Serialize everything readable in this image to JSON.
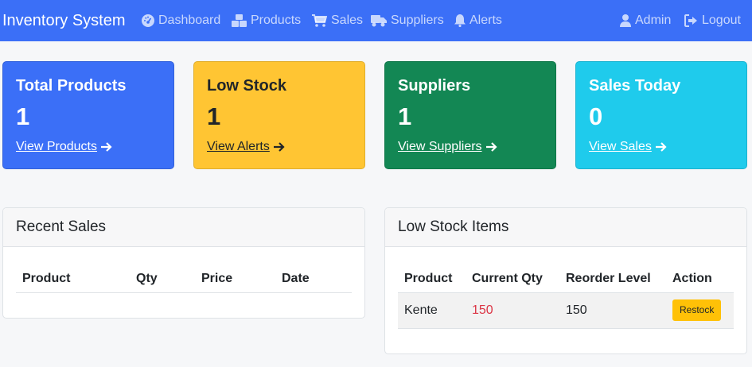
{
  "navbar": {
    "brand": "Inventory System",
    "links": [
      "Dashboard",
      "Products",
      "Sales",
      "Suppliers",
      "Alerts"
    ],
    "admin_label": "Admin",
    "logout_label": "Logout",
    "background": "#3b6ff7"
  },
  "cards": [
    {
      "title": "Total Products",
      "value": "1",
      "link": "View Products",
      "color": "#3b6ff7"
    },
    {
      "title": "Low Stock",
      "value": "1",
      "link": "View Alerts",
      "color": "#ffc533"
    },
    {
      "title": "Suppliers",
      "value": "1",
      "link": "View Suppliers",
      "color": "#138754"
    },
    {
      "title": "Sales Today",
      "value": "0",
      "link": "View Sales",
      "color": "#1fcbec"
    }
  ],
  "recent_sales": {
    "title": "Recent Sales",
    "columns": [
      "Product",
      "Qty",
      "Price",
      "Date"
    ],
    "rows": []
  },
  "low_stock": {
    "title": "Low Stock Items",
    "columns": [
      "Product",
      "Current Qty",
      "Reorder Level",
      "Action"
    ],
    "rows": [
      {
        "product": "Kente",
        "current_qty": "150",
        "reorder_level": "150",
        "action": "Restock"
      }
    ]
  }
}
